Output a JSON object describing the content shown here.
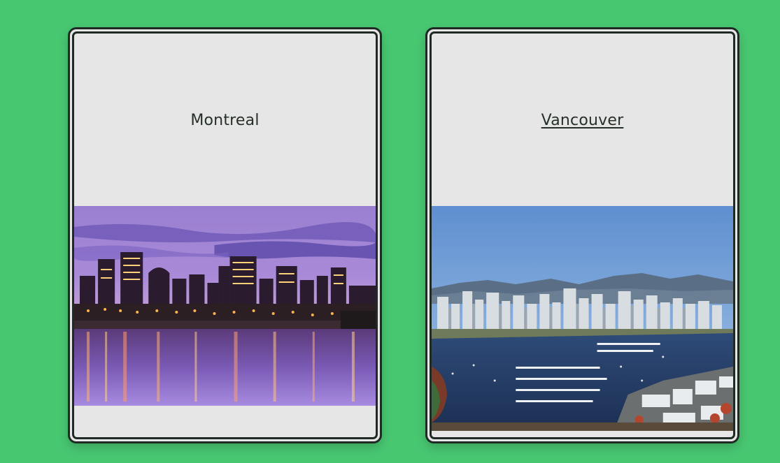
{
  "cards": [
    {
      "title": "Montreal",
      "image": "montreal-night-skyline-photo"
    },
    {
      "title": "Vancouver",
      "image": "vancouver-harbour-aerial-photo"
    }
  ],
  "colors": {
    "background": "#48c771",
    "card": "#e6e6e6",
    "border": "#1f2a24",
    "text": "#263029"
  }
}
